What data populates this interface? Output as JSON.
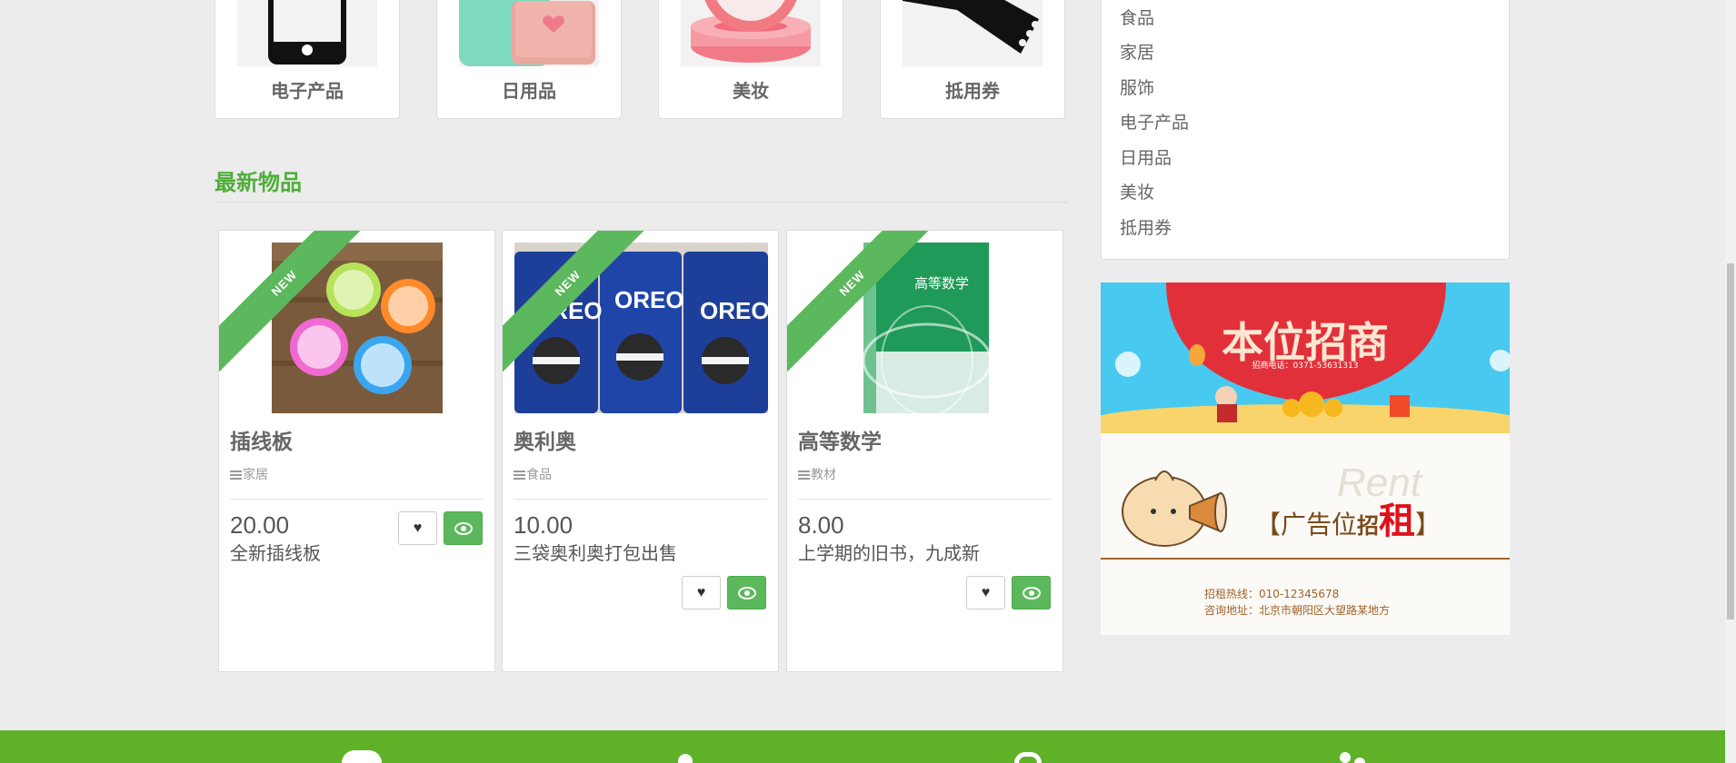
{
  "categories": [
    {
      "label": "电子产品",
      "icon": "phone-icon"
    },
    {
      "label": "日用品",
      "icon": "daily-goods-icon"
    },
    {
      "label": "美妆",
      "icon": "cosmetics-icon"
    },
    {
      "label": "抵用券",
      "icon": "voucher-icon"
    }
  ],
  "latest": {
    "title": "最新物品"
  },
  "products": [
    {
      "ribbon": "NEW",
      "title": "插线板",
      "category": "家居",
      "price": "20.00",
      "description": "全新插线板",
      "image": "power-strip-image"
    },
    {
      "ribbon": "NEW",
      "title": "奥利奥",
      "category": "食品",
      "price": "10.00",
      "description": "三袋奥利奥打包出售",
      "image": "oreo-image",
      "image_text": "OREO"
    },
    {
      "ribbon": "NEW",
      "title": "高等数学",
      "category": "教材",
      "price": "8.00",
      "description": "上学期的旧书，九成新",
      "image": "math-book-image",
      "image_text": "高等数学"
    }
  ],
  "sidebar": {
    "items": [
      "食品",
      "家居",
      "服饰",
      "电子产品",
      "日用品",
      "美妆",
      "抵用券"
    ]
  },
  "ad": {
    "headline": "本位招商",
    "sub_phone": "招商电话：0371-53631313",
    "rent_prefix": "广告位",
    "rent_zhao": "招",
    "rent_zu": "租",
    "watermark": "Rent",
    "hotline": "招租热线：010-12345678",
    "address": "咨询地址：北京市朝阳区大望路某地方"
  },
  "colors": {
    "brand_green": "#5fb227",
    "button_green": "#5cb85c",
    "title_green": "#4fae3a"
  }
}
